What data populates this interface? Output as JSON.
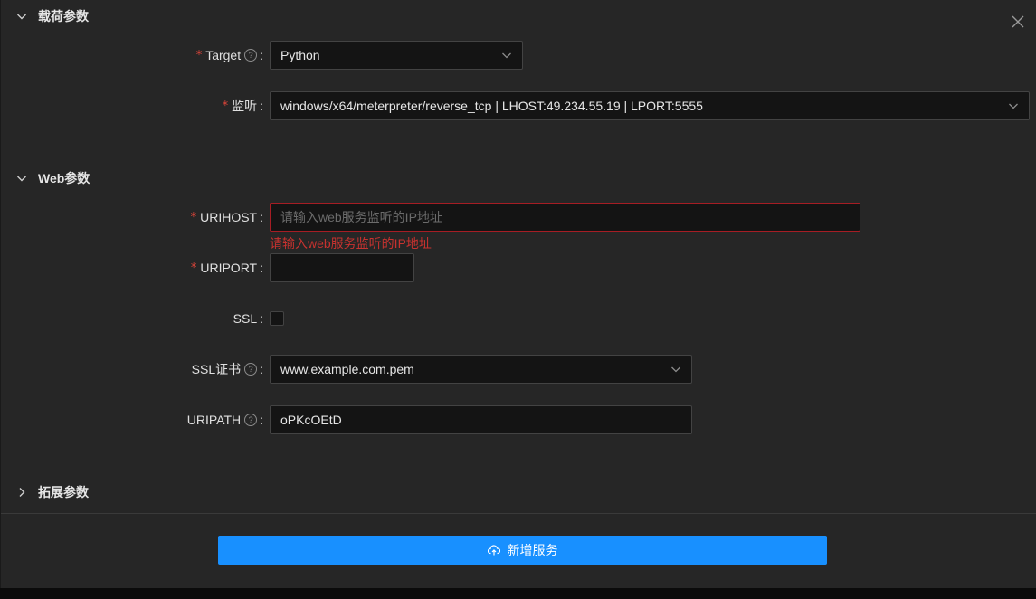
{
  "panels": {
    "payload": {
      "title": "载荷参数"
    },
    "web": {
      "title": "Web参数"
    },
    "extended": {
      "title": "拓展参数"
    }
  },
  "fields": {
    "target": {
      "label": "Target",
      "value": "Python"
    },
    "listener": {
      "label": "监听",
      "value": "windows/x64/meterpreter/reverse_tcp | LHOST:49.234.55.19 | LPORT:5555"
    },
    "urihost": {
      "label": "URIHOST",
      "placeholder": "请输入web服务监听的IP地址",
      "error": "请输入web服务监听的IP地址"
    },
    "uriport": {
      "label": "URIPORT",
      "value": ""
    },
    "ssl": {
      "label": "SSL",
      "checked": false
    },
    "ssl_cert": {
      "label": "SSL证书",
      "value": "www.example.com.pem"
    },
    "uripath": {
      "label": "URIPATH",
      "value": "oPKcOEtD"
    }
  },
  "common": {
    "required_mark": "*",
    "colon": ":",
    "help_glyph": "?"
  },
  "submit": {
    "label": "新增服务",
    "icon": "cloud-upload-icon"
  },
  "colors": {
    "primary": "#1890ff",
    "error": "#c7322f",
    "panel_bg": "#262626",
    "input_bg": "#141414"
  }
}
